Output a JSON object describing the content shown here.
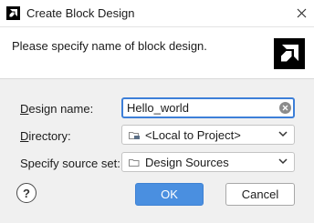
{
  "window": {
    "title": "Create Block Design",
    "close_icon": "close-icon",
    "app_icon": "amd-logo-icon"
  },
  "header": {
    "message": "Please specify name of block design.",
    "logo": "amd-logo"
  },
  "form": {
    "design_name": {
      "label_mnemonic": "D",
      "label_rest": "esign name:",
      "value": "Hello_world"
    },
    "directory": {
      "label_mnemonic": "D",
      "label_rest": "irectory:",
      "value": "<Local to Project>",
      "icon": "folder-link-icon"
    },
    "source_set": {
      "label": "Specify source set:",
      "value": "Design Sources",
      "icon": "folder-icon"
    }
  },
  "buttons": {
    "help": "?",
    "ok": "OK",
    "cancel": "Cancel"
  },
  "colors": {
    "accent": "#4a8fe0",
    "focus_border": "#3d7fd8"
  }
}
